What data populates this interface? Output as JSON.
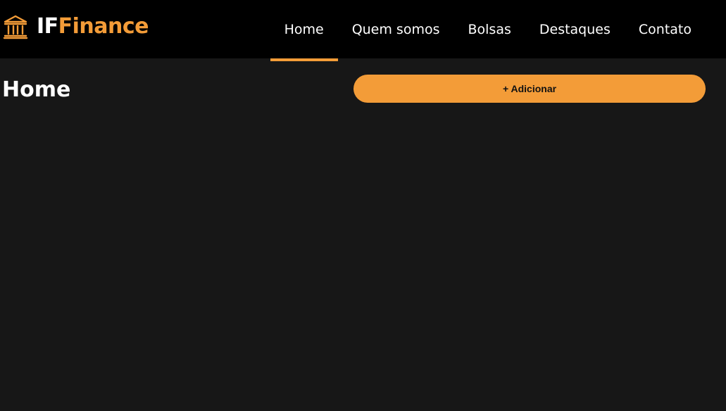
{
  "brand": {
    "icon": "bank-building-icon",
    "name_part1": "IF",
    "name_part2": "Finance",
    "colors": {
      "primary": "#ffffff",
      "accent": "#f39c38"
    }
  },
  "nav": {
    "items": [
      {
        "label": "Home",
        "active": true
      },
      {
        "label": "Quem somos",
        "active": false
      },
      {
        "label": "Bolsas",
        "active": false
      },
      {
        "label": "Destaques",
        "active": false
      },
      {
        "label": "Contato",
        "active": false
      }
    ]
  },
  "main": {
    "title": "Home",
    "add_button_label": "+ Adicionar"
  },
  "theme": {
    "header_bg": "#000000",
    "page_bg": "#171717",
    "accent": "#f39c38"
  }
}
